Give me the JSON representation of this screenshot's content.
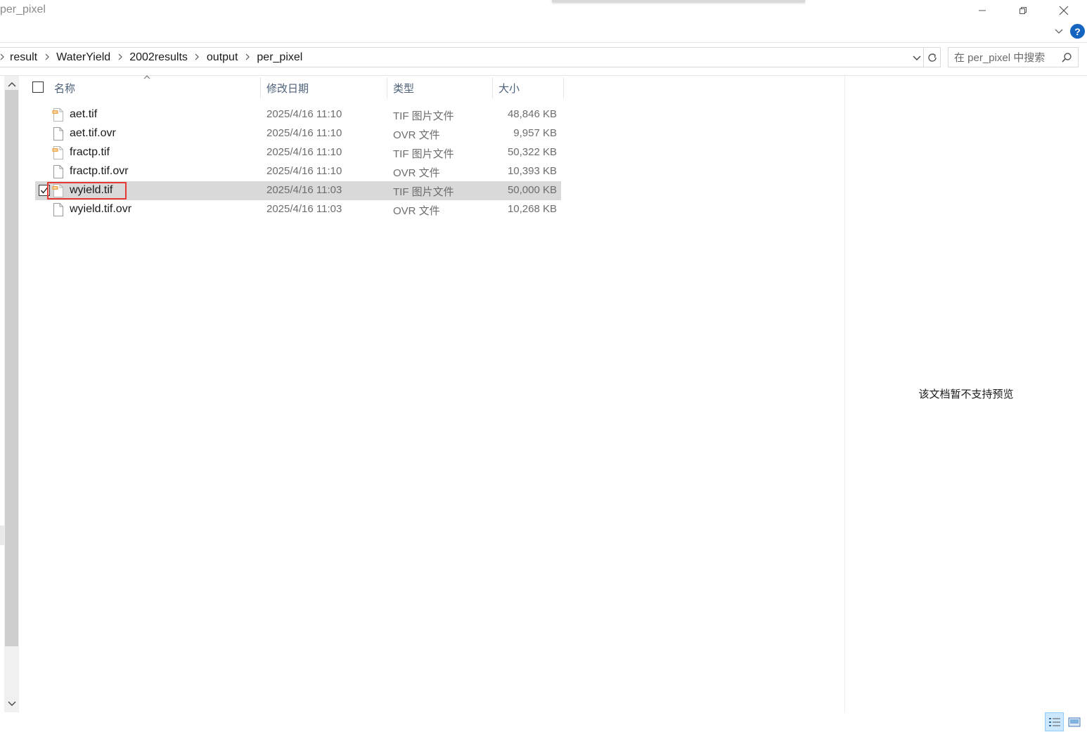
{
  "window": {
    "title": "per_pixel"
  },
  "address": {
    "breadcrumbs": [
      "result",
      "WaterYield",
      "2002results",
      "output",
      "per_pixel"
    ]
  },
  "search": {
    "placeholder": "在 per_pixel 中搜索"
  },
  "columns": {
    "name": "名称",
    "date": "修改日期",
    "type": "类型",
    "size": "大小"
  },
  "files": [
    {
      "name": "aet.tif",
      "date": "2025/4/16 11:10",
      "type": "TIF 图片文件",
      "size": "48,846 KB",
      "icon": "tif-image-icon",
      "selected": false
    },
    {
      "name": "aet.tif.ovr",
      "date": "2025/4/16 11:10",
      "type": "OVR 文件",
      "size": "9,957 KB",
      "icon": "blank-file-icon",
      "selected": false
    },
    {
      "name": "fractp.tif",
      "date": "2025/4/16 11:10",
      "type": "TIF 图片文件",
      "size": "50,322 KB",
      "icon": "tif-image-icon",
      "selected": false
    },
    {
      "name": "fractp.tif.ovr",
      "date": "2025/4/16 11:10",
      "type": "OVR 文件",
      "size": "10,393 KB",
      "icon": "blank-file-icon",
      "selected": false
    },
    {
      "name": "wyield.tif",
      "date": "2025/4/16 11:03",
      "type": "TIF 图片文件",
      "size": "50,000 KB",
      "icon": "tif-image-icon",
      "selected": true
    },
    {
      "name": "wyield.tif.ovr",
      "date": "2025/4/16 11:03",
      "type": "OVR 文件",
      "size": "10,268 KB",
      "icon": "blank-file-icon",
      "selected": false
    }
  ],
  "preview": {
    "message": "该文档暂不支持预览"
  },
  "colors": {
    "selected_row": "#d9d9d9",
    "highlight_box": "#e53935",
    "help_icon": "#1565c0",
    "tif_icon_accent": "#f0a64a"
  }
}
